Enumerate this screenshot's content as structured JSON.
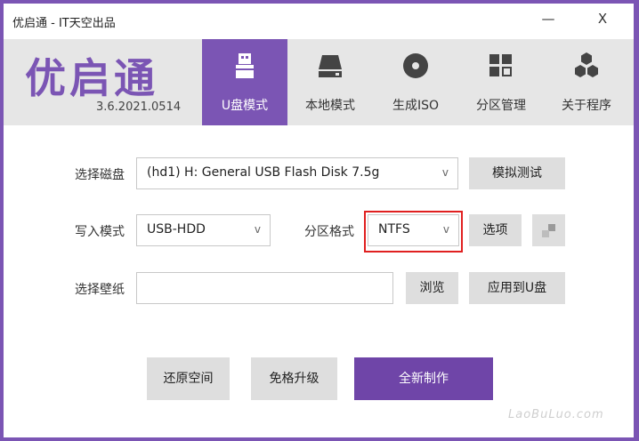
{
  "window": {
    "title": "优启通 - IT天空出品",
    "minimize_glyph": "—",
    "close_glyph": "X"
  },
  "header": {
    "logo": "优启通",
    "version": "3.6.2021.0514",
    "tabs": [
      {
        "label": "U盘模式",
        "icon": "usb-drive-icon",
        "active": true
      },
      {
        "label": "本地模式",
        "icon": "hard-disk-icon",
        "active": false
      },
      {
        "label": "生成ISO",
        "icon": "disc-icon",
        "active": false
      },
      {
        "label": "分区管理",
        "icon": "partition-grid-icon",
        "active": false
      },
      {
        "label": "关于程序",
        "icon": "hexagons-icon",
        "active": false
      }
    ]
  },
  "form": {
    "disk_label": "选择磁盘",
    "disk_value": "(hd1) H: General USB Flash Disk 7.5g",
    "simulate_button": "模拟测试",
    "write_mode_label": "写入模式",
    "write_mode_value": "USB-HDD",
    "partition_format_label": "分区格式",
    "partition_format_value": "NTFS",
    "options_button": "选项",
    "wallpaper_label": "选择壁纸",
    "wallpaper_value": "",
    "browse_button": "浏览",
    "apply_button": "应用到U盘",
    "dropdown_arrow": "v"
  },
  "actions": {
    "restore_button": "还原空间",
    "upgrade_button": "免格升级",
    "create_button": "全新制作"
  },
  "watermark": "LaoBuLuo.com",
  "colors": {
    "accent": "#7b55b4",
    "highlight": "#e02020"
  }
}
